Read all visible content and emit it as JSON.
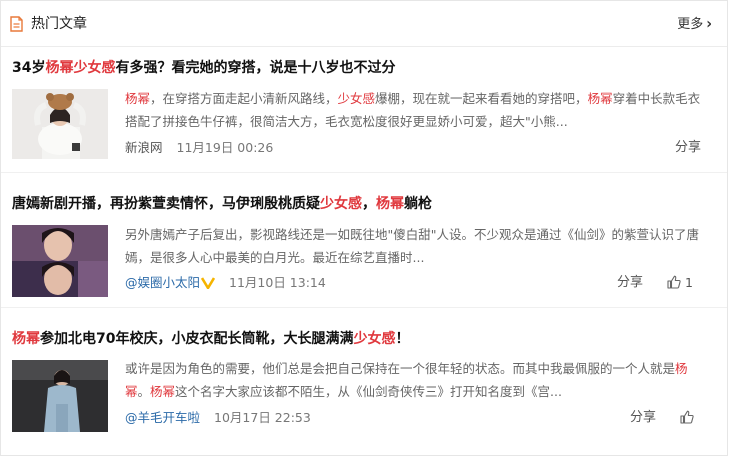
{
  "header": {
    "title": "热门文章",
    "more_label": "更多"
  },
  "articles": [
    {
      "title_segments": [
        {
          "text": "34岁",
          "hl": false
        },
        {
          "text": "杨幂",
          "hl": true
        },
        {
          "text": "少女感",
          "hl": true
        },
        {
          "text": "有多强？看完她的穿搭，说是十八岁也不过分",
          "hl": false
        }
      ],
      "summary_segments": [
        {
          "text": "杨幂",
          "hl": true
        },
        {
          "text": "，在穿搭方面走起小清新风路线，",
          "hl": false
        },
        {
          "text": "少女感",
          "hl": true
        },
        {
          "text": "爆棚，现在就一起来看看她的穿搭吧，",
          "hl": false
        },
        {
          "text": "杨幂",
          "hl": true
        },
        {
          "text": "穿着中长款毛衣搭配了拼接色牛仔裤，很简洁大方，毛衣宽松度很好更显娇小可爱，超大\"小熊...",
          "hl": false
        }
      ],
      "source": "新浪网",
      "time": "11月19日 00:26",
      "share_label": "分享",
      "like_count": ""
    },
    {
      "title_segments": [
        {
          "text": "唐嫣新剧开播，再扮紫萱卖情怀，马伊琍殷桃质疑",
          "hl": false
        },
        {
          "text": "少女感",
          "hl": true
        },
        {
          "text": "，",
          "hl": false
        },
        {
          "text": "杨幂",
          "hl": true
        },
        {
          "text": "躺枪",
          "hl": false
        }
      ],
      "summary_segments": [
        {
          "text": "另外唐嫣产子后复出，影视路线还是一如既往地\"傻白甜\"人设。不少观众是通过《仙剑》的紫萱认识了唐嫣，是很多人心中最美的白月光。最近在综艺直播时...",
          "hl": false
        }
      ],
      "source": "@娱圈小太阳",
      "time": "11月10日 13:14",
      "share_label": "分享",
      "like_count": "1"
    },
    {
      "title_segments": [
        {
          "text": "杨幂",
          "hl": true
        },
        {
          "text": "参加北电70年校庆，小皮衣配长筒靴，大长腿满满",
          "hl": false
        },
        {
          "text": "少女感",
          "hl": true
        },
        {
          "text": "！",
          "hl": false
        }
      ],
      "summary_segments": [
        {
          "text": "或许是因为角色的需要，他们总是会把自己保持在一个很年轻的状态。而其中我最佩服的一个人就是",
          "hl": false
        },
        {
          "text": "杨幂",
          "hl": true
        },
        {
          "text": "。",
          "hl": false
        },
        {
          "text": "杨幂",
          "hl": true
        },
        {
          "text": "这个名字大家应该都不陌生，从《仙剑奇侠传三》打开知名度到《宫...",
          "hl": false
        }
      ],
      "source": "@羊毛开车啦",
      "time": "10月17日 22:53",
      "share_label": "分享",
      "like_count": ""
    }
  ],
  "colors": {
    "highlight": "#e0393e",
    "link": "#2b6aa8",
    "badge": "#f5b400"
  },
  "icons": {
    "header": "document-icon",
    "more": "chevron-right-icon",
    "verified": "verified-badge-icon",
    "like": "thumbs-up-icon"
  }
}
